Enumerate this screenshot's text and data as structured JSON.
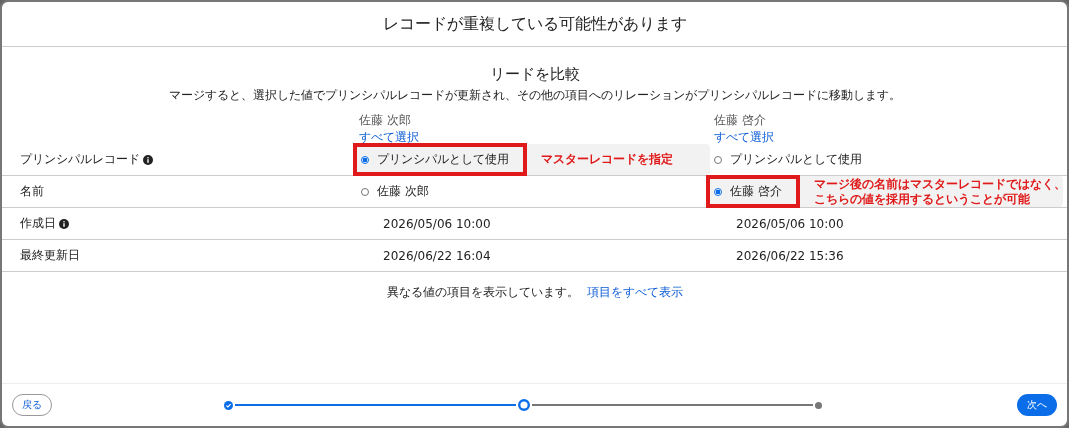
{
  "dialog": {
    "title": "レコードが重複している可能性があります"
  },
  "compare": {
    "heading": "リードを比較",
    "description": "マージすると、選択した値でプリンシパルレコードが更新され、その他の項目へのリレーションがプリンシパルレコードに移動します。"
  },
  "records": [
    {
      "name": "佐藤 次郎",
      "select_all": "すべて選択"
    },
    {
      "name": "佐藤 啓介",
      "select_all": "すべて選択"
    }
  ],
  "rows": [
    {
      "label": "プリンシパルレコード",
      "info": true,
      "cells": [
        {
          "kind": "radio",
          "text": "プリンシパルとして使用",
          "selected": true,
          "marked": true,
          "note": "マスターレコードを指定"
        },
        {
          "kind": "radio",
          "text": "プリンシパルとして使用",
          "selected": false,
          "marked": false
        }
      ]
    },
    {
      "label": "名前",
      "info": false,
      "cells": [
        {
          "kind": "radio",
          "text": "佐藤 次郎",
          "selected": false,
          "marked": false
        },
        {
          "kind": "radio",
          "text": "佐藤 啓介",
          "selected": true,
          "marked": true,
          "note_lines": [
            "マージ後の名前はマスターレコードではなく、",
            "こちらの値を採用するということが可能"
          ]
        }
      ]
    },
    {
      "label": "作成日",
      "info": true,
      "cells": [
        {
          "kind": "text",
          "text": "2026/05/06 10:00"
        },
        {
          "kind": "text",
          "text": "2026/05/06 10:00"
        }
      ]
    },
    {
      "label": "最終更新日",
      "info": false,
      "cells": [
        {
          "kind": "text",
          "text": "2026/06/22 16:04"
        },
        {
          "kind": "text",
          "text": "2026/06/22 15:36"
        }
      ]
    }
  ],
  "filter_note": {
    "text": "異なる値の項目を表示しています。",
    "link": "項目をすべて表示"
  },
  "footer": {
    "back": "戻る",
    "next": "次へ",
    "steps": [
      {
        "completed": true,
        "selected": false
      },
      {
        "completed": false,
        "selected": true
      },
      {
        "completed": false,
        "selected": false
      }
    ]
  }
}
